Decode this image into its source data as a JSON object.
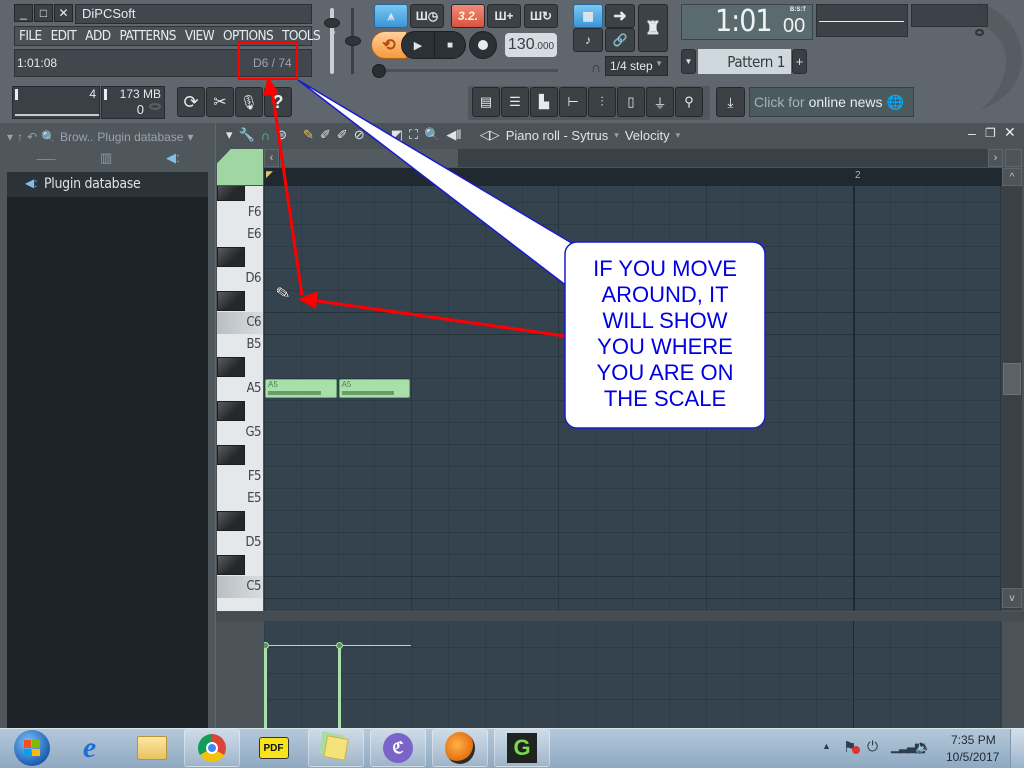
{
  "window": {
    "title": "DiPCSoft",
    "controls": {
      "minimize": "_",
      "maximize": "□",
      "close": "✕"
    }
  },
  "menu": [
    "FILE",
    "EDIT",
    "ADD",
    "PATTERNS",
    "VIEW",
    "OPTIONS",
    "TOOLS",
    "?"
  ],
  "hint_bar": {
    "position": "1:01:08",
    "note_readout": "D6 / 74"
  },
  "meters": {
    "cpu": "4",
    "memory": "173 MB",
    "polyphony": "0"
  },
  "transport": {
    "time_signature": "3.2.",
    "tempo": "130",
    "tempo_decimal": ".000",
    "snap": "1/4 step",
    "time_main": "1:01",
    "time_sub": "00",
    "time_format": "B:S:T",
    "pattern": "Pattern 1"
  },
  "news": {
    "prefix": "Click for ",
    "highlight": "online news"
  },
  "browser": {
    "header_short": "Brow..",
    "header_title": "Plugin database",
    "items": [
      "Plugin database"
    ]
  },
  "piano_roll": {
    "title": "Piano roll - Sytrus",
    "target": "Velocity",
    "bar_marker": "2",
    "keys": [
      "F6",
      "E6",
      "D6",
      "C6",
      "B5",
      "A5",
      "G5",
      "F5",
      "E5",
      "D5",
      "C5"
    ],
    "notes": [
      {
        "label": "A5",
        "velocity": 0.78
      },
      {
        "label": "A5",
        "velocity": 0.78
      }
    ]
  },
  "annotation": {
    "callout_lines": [
      "IF YOU MOVE",
      "AROUND, IT",
      "WILL SHOW",
      "YOU WHERE",
      "YOU ARE ON",
      "THE SCALE"
    ],
    "arrow_color": "#ff0000",
    "text_color": "#0000e0",
    "border_color": "#1a1ad0"
  },
  "taskbar": {
    "apps": [
      "start",
      "internet-explorer",
      "file-explorer",
      "chrome",
      "pdf-reader",
      "sticky-notes",
      "bittorrent",
      "fl-studio",
      "camtasia"
    ],
    "time": "7:35 PM",
    "date": "10/5/2017"
  },
  "colors": {
    "accent_blue": "#3b95d6",
    "note_green": "#a8e0aa",
    "grid_bg": "#34434d"
  }
}
